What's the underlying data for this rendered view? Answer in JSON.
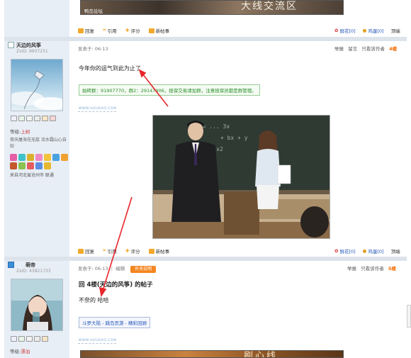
{
  "top_banner": {
    "watermark": "鸭岛论坛",
    "title": "大线交流区"
  },
  "prev_post_actions": {
    "reply": "回复",
    "quote": "引用",
    "rate": "评分",
    "new_post": "新帖事",
    "flower": "鲜花[0]",
    "egg": "鸡蛋[0]",
    "top": "顶端"
  },
  "post4": {
    "user": {
      "name": "天边的风筝",
      "uid": "ZxID: 9607251",
      "level_label": "等级:",
      "level_value": "上树",
      "signature": "倚天屠海花无敌  流水霜山心自知",
      "location": "来自河北省沧州市 联通"
    },
    "posted": "发表于: 06-13",
    "links": [
      "举报",
      "留言",
      "只看该作者"
    ],
    "floor": "4楼",
    "text": "今年你的运气到此为止了",
    "notice": "拍砖群：91907770，群2：29147906，担保交易请加群，注意担保员都是群管理。",
    "site_tag": "WWW.HOUDAO.COM",
    "actions": {
      "reply": "回复",
      "quote": "引用",
      "rate": "评分",
      "new_post": "新帖事",
      "flower": "鲜花[0]",
      "egg": "鸡蛋[0]",
      "top": "顶端"
    }
  },
  "post5": {
    "user": {
      "name": "萌帝",
      "uid": "ZxID: 43821733",
      "level_label": "等级:",
      "level_value": "漂泊"
    },
    "posted": "发表于: 06-13",
    "edit": "编辑",
    "edit_badge": "补充说明",
    "links": [
      "举报",
      "只看该作者"
    ],
    "floor": "5楼",
    "reply_title": "回 4楼(天边的风筝) 的帖子",
    "text": "不奈的 哈哈",
    "link_box": "斗罗大陆 - 跳岛页游 - 精彩回顾",
    "site_tag": "WWW.HOUDAO.COM"
  },
  "bottom_banner": {
    "title": "刷心线"
  },
  "colors": {
    "accent_orange": "#f26c00",
    "notice_green": "#2a8d2a",
    "link_blue": "#2355b8",
    "arrow_red": "#e8262b"
  }
}
